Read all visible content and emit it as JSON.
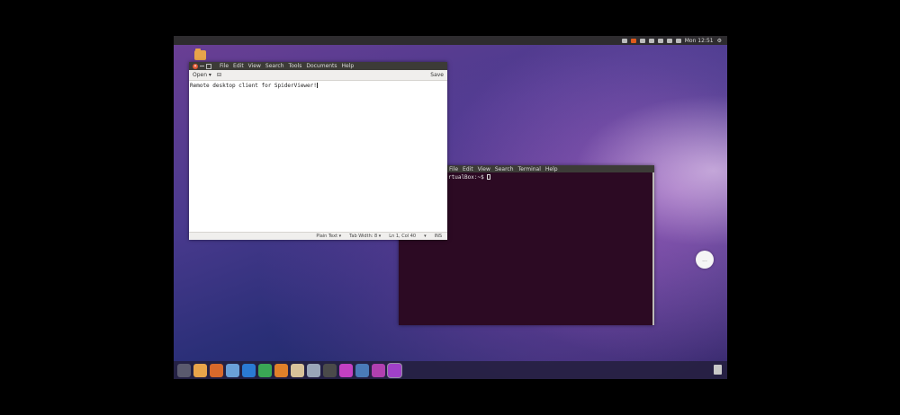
{
  "top_panel": {
    "clock": "Mon 12:51",
    "indicators": [
      "battery-icon",
      "share-icon",
      "mail-icon",
      "keyboard-icon",
      "network-icon",
      "bluetooth-icon",
      "volume-icon"
    ]
  },
  "gedit": {
    "menu": [
      "File",
      "Edit",
      "View",
      "Search",
      "Tools",
      "Documents",
      "Help"
    ],
    "toolbar": {
      "open_label": "Open ▾",
      "save_label": "Save"
    },
    "content": "Remote desktop client for SpiderViewer!",
    "status": {
      "syntax": "Plain Text ▾",
      "tab_width": "Tab Width: 8 ▾",
      "position": "Ln 1, Col 40",
      "mode_arrow": "▾",
      "ins": "INS"
    }
  },
  "terminal": {
    "menu": [
      "File",
      "Edit",
      "View",
      "Search",
      "Terminal",
      "Help"
    ],
    "prompt": "rtualBox:~$ "
  },
  "floating_button": {
    "label": "..."
  },
  "dock": {
    "apps": [
      {
        "name": "dash-icon",
        "color": "#5a5a6e"
      },
      {
        "name": "files-icon",
        "color": "#e8a44a"
      },
      {
        "name": "firefox-icon",
        "color": "#d9692b"
      },
      {
        "name": "chromium-icon",
        "color": "#6aa0d8"
      },
      {
        "name": "writer-icon",
        "color": "#2a7ad4"
      },
      {
        "name": "calc-icon",
        "color": "#3aa655"
      },
      {
        "name": "impress-icon",
        "color": "#e0802a"
      },
      {
        "name": "software-center-icon",
        "color": "#d8c29a"
      },
      {
        "name": "system-settings-icon",
        "color": "#9aa6b8"
      },
      {
        "name": "terminal-icon",
        "color": "#4a4a4a"
      },
      {
        "name": "remote-viewer-icon",
        "color": "#c340c3"
      },
      {
        "name": "text-editor-icon",
        "color": "#4a7ab8"
      },
      {
        "name": "screen-icon",
        "color": "#b040b0"
      },
      {
        "name": "pen-tool-icon",
        "color": "#a040c8"
      }
    ]
  }
}
